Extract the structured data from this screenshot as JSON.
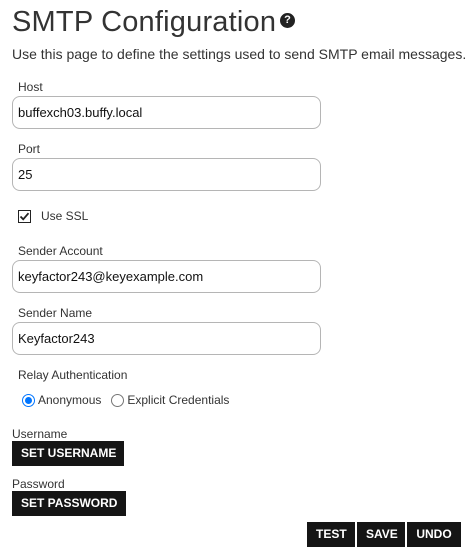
{
  "header": {
    "title": "SMTP Configuration",
    "help_icon": "question-circle-icon",
    "help_glyph": "?",
    "subtitle": "Use this page to define the settings used to send SMTP email messages."
  },
  "form": {
    "host": {
      "label": "Host",
      "value": "buffexch03.buffy.local"
    },
    "port": {
      "label": "Port",
      "value": "25"
    },
    "use_ssl": {
      "label": "Use SSL",
      "checked": true,
      "icon": "checkbox-checked-icon"
    },
    "sender_account": {
      "label": "Sender Account",
      "value": "keyfactor243@keyexample.com"
    },
    "sender_name": {
      "label": "Sender Name",
      "value": "Keyfactor243"
    },
    "relay_authentication": {
      "label": "Relay Authentication",
      "options": [
        {
          "label": "Anonymous",
          "selected": true
        },
        {
          "label": "Explicit Credentials",
          "selected": false
        }
      ]
    },
    "username": {
      "label": "Username",
      "button_label": "SET USERNAME"
    },
    "password": {
      "label": "Password",
      "button_label": "SET PASSWORD"
    }
  },
  "actions": {
    "test_label": "TEST",
    "save_label": "SAVE",
    "undo_label": "UNDO"
  },
  "colors": {
    "button_background": "#151515",
    "button_text": "#ffffff",
    "radio_accent": "#0075ff",
    "input_border": "#b5b5b5"
  }
}
